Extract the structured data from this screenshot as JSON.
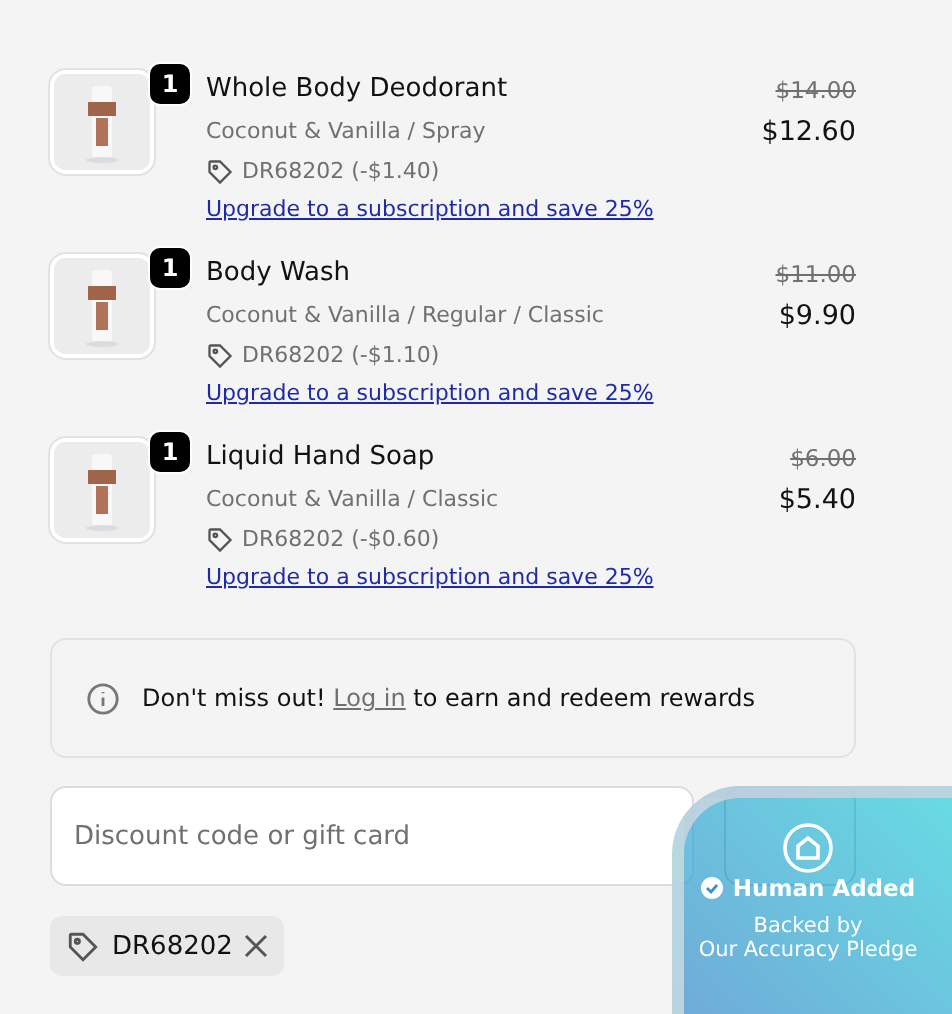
{
  "items": [
    {
      "quantity": "1",
      "name": "Whole Body Deodorant",
      "variant": "Coconut & Vanilla / Spray",
      "discount": "DR68202 (-$1.40)",
      "upgrade_link": "Upgrade to a subscription and save 25%",
      "original_price": "$14.00",
      "price": "$12.60"
    },
    {
      "quantity": "1",
      "name": "Body Wash",
      "variant": "Coconut & Vanilla / Regular / Classic",
      "discount": "DR68202 (-$1.10)",
      "upgrade_link": "Upgrade to a subscription and save 25%",
      "original_price": "$11.00",
      "price": "$9.90"
    },
    {
      "quantity": "1",
      "name": "Liquid Hand Soap",
      "variant": "Coconut & Vanilla / Classic",
      "discount": "DR68202 (-$0.60)",
      "upgrade_link": "Upgrade to a subscription and save 25%",
      "original_price": "$6.00",
      "price": "$5.40"
    }
  ],
  "rewards_notice": {
    "before": "Don't miss out!",
    "link": "Log in",
    "after": "to earn and redeem rewards"
  },
  "discount_field": {
    "placeholder": "Discount code or gift card"
  },
  "applied_codes": [
    {
      "code": "DR68202"
    }
  ],
  "trust_badge": {
    "title": "Human Added",
    "line_1": "Backed by",
    "line_2": "Our Accuracy Pledge"
  }
}
